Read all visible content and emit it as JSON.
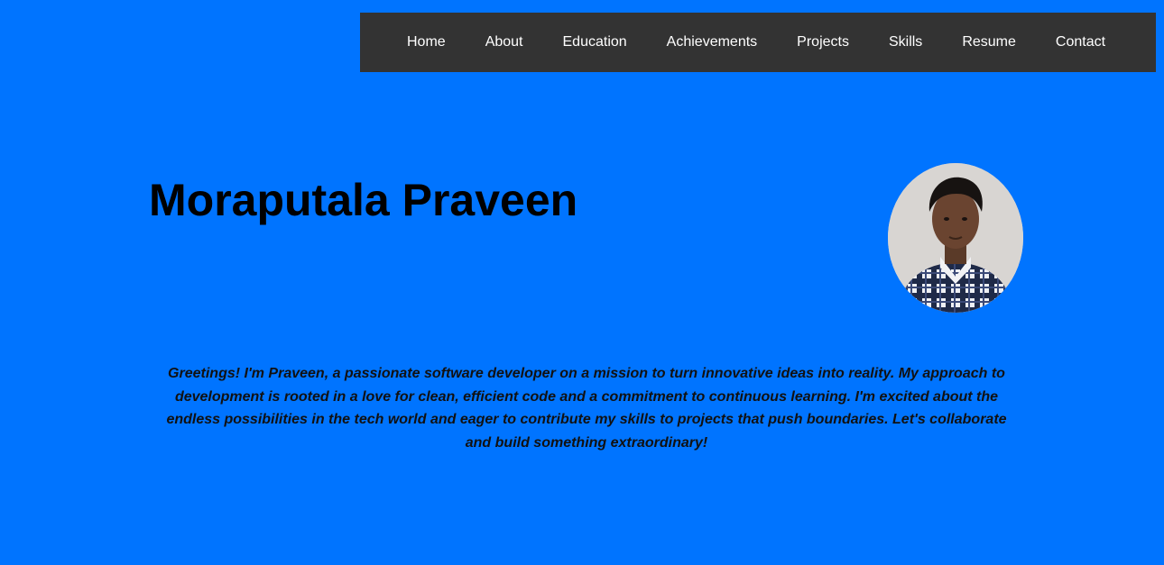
{
  "nav": {
    "items": [
      {
        "label": "Home"
      },
      {
        "label": "About"
      },
      {
        "label": "Education"
      },
      {
        "label": "Achievements"
      },
      {
        "label": "Projects"
      },
      {
        "label": "Skills"
      },
      {
        "label": "Resume"
      },
      {
        "label": "Contact"
      }
    ]
  },
  "hero": {
    "name": "Moraputala Praveen",
    "bio": "Greetings! I'm Praveen, a passionate software developer on a mission to turn innovative ideas into reality. My approach to development is rooted in a love for clean, efficient code and a commitment to continuous learning. I'm excited about the endless possibilities in the tech world and eager to contribute my skills to projects that push boundaries. Let's collaborate and build something extraordinary!"
  },
  "colors": {
    "background": "#0074ff",
    "navbar": "#333333",
    "nav_text": "#ffffff",
    "text": "#000000"
  }
}
